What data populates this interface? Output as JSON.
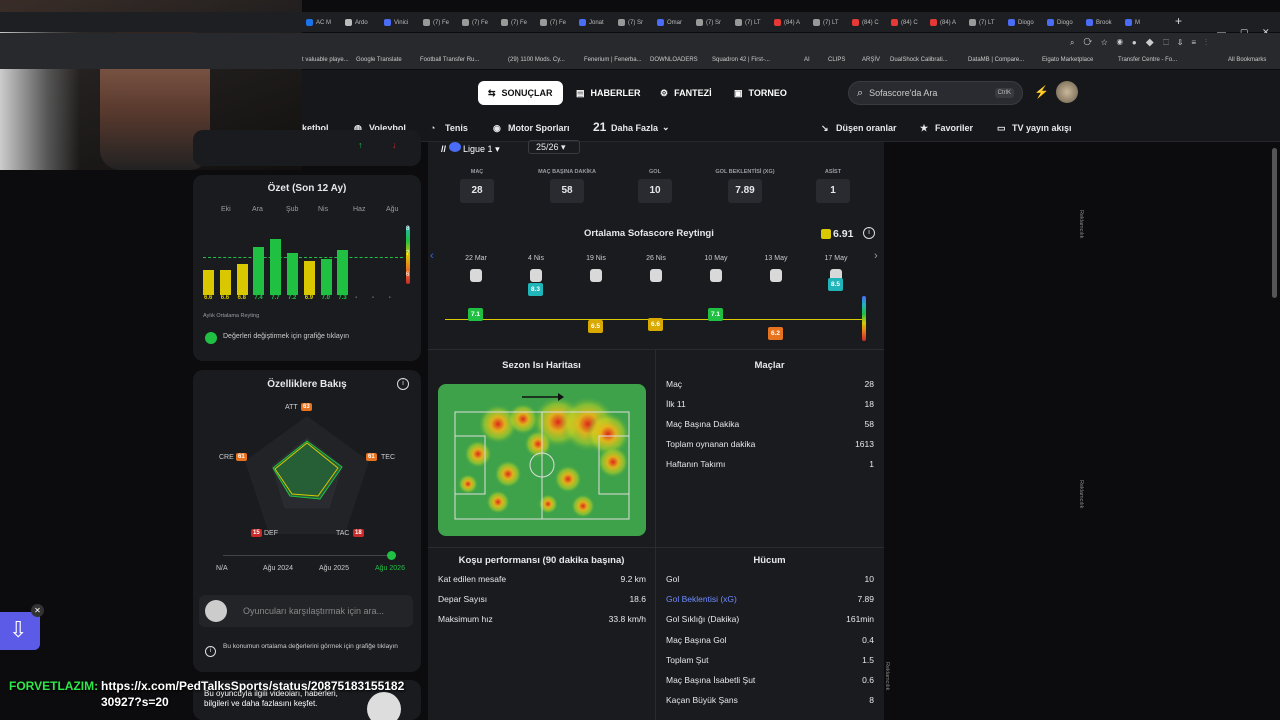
{
  "browser": {
    "tabs": [
      {
        "label": "AC M",
        "c": "#1a73e8"
      },
      {
        "label": "Ardo",
        "c": "#bbb"
      },
      {
        "label": "Vinici",
        "c": "#4a6cf7"
      },
      {
        "label": "(7) Fe",
        "c": "#999"
      },
      {
        "label": "(7) Fe",
        "c": "#999"
      },
      {
        "label": "(7) Fe",
        "c": "#999"
      },
      {
        "label": "(7) Fe",
        "c": "#999"
      },
      {
        "label": "Jonat",
        "c": "#4a6cf7"
      },
      {
        "label": "(7) Sr",
        "c": "#999"
      },
      {
        "label": "Omar",
        "c": "#4a6cf7"
      },
      {
        "label": "(7) Sr",
        "c": "#999"
      },
      {
        "label": "(7) LT",
        "c": "#999"
      },
      {
        "label": "(84) A",
        "c": "#e53935"
      },
      {
        "label": "(7) LT",
        "c": "#999"
      },
      {
        "label": "(84) C",
        "c": "#e53935"
      },
      {
        "label": "(84) C",
        "c": "#e53935"
      },
      {
        "label": "(84) A",
        "c": "#e53935"
      },
      {
        "label": "(7) LT",
        "c": "#999"
      },
      {
        "label": "Diogo",
        "c": "#4a6cf7"
      },
      {
        "label": "Diogo",
        "c": "#4a6cf7"
      },
      {
        "label": "Brook",
        "c": "#4a6cf7"
      },
      {
        "label": "M",
        "c": "#4a6cf7"
      }
    ],
    "bookmarks": [
      "t valuable playe...",
      "Google Translate",
      "Football Transfer Ru...",
      "(29) 1100 Mods. Cy...",
      "Fenerium | Fenerba...",
      "DOWNLOADERS",
      "Squadron 42 | First-...",
      "AI",
      "CLIPS",
      "ARŞİV",
      "DualShock Calibrati...",
      "DataMB | Compare...",
      "Eigato Marketplace",
      "Transfer Centre - Fo...",
      "All Bookmarks"
    ]
  },
  "nav": {
    "sonuclar": "SONUÇLAR",
    "haberler": "HABERLER",
    "fantezi": "FANTEZİ",
    "torneo": "TORNEO",
    "search_placeholder": "Sofascore'da Ara",
    "search_kbd": "CtrlK"
  },
  "sports": {
    "basketbol": "ketbol",
    "voleybol": "Voleybol",
    "tenis": "Tenis",
    "motor": "Motor Sporları",
    "more_count": "21",
    "more": "Daha Fazla",
    "odds": "Düşen oranlar",
    "favorites": "Favoriler",
    "tv": "TV yayın akışı"
  },
  "left": {
    "summary_title": "Özet (Son 12 Ay)",
    "months": [
      "Eki",
      "Ara",
      "Şub",
      "Nis",
      "Haz",
      "Ağu"
    ],
    "bar_ratings": [
      6.6,
      6.6,
      6.8,
      7.4,
      7.7,
      7.2,
      6.9,
      7.0,
      7.3
    ],
    "bar_labels": [
      "6.6",
      "6.6",
      "6.8",
      "7.4",
      "7.7",
      "7.2",
      "6.9",
      "7.0",
      "7.3",
      "-",
      "-",
      "-"
    ],
    "scale": [
      "8",
      "7",
      "6"
    ],
    "monthly_label": "Aylık Ortalama Reyting",
    "hint": "Değerleri değiştirmek için grafiğe tıklayın",
    "attr_title": "Özelliklere Bakış",
    "attrs": {
      "att_label": "ATT",
      "att": "63",
      "tec_label": "TEC",
      "tec": "61",
      "tac_label": "TAC",
      "tac": "18",
      "def_label": "DEF",
      "def": "15",
      "cre_label": "CRE",
      "cre": "61"
    },
    "timeline": [
      "N/A",
      "Ağu 2024",
      "Ağu 2025",
      "Ağu 2026"
    ],
    "compare_placeholder": "Oyuncuları karşılaştırmak için ara...",
    "avg_hint": "Bu konumun ortalama değerlerini görmek için grafiğe tıklayın",
    "video_text": "Bu oyuncuyla ilgili videoları, haberleri, bilgileri ve daha fazlasını keşfet."
  },
  "mid": {
    "league": "Ligue 1",
    "season": "25/26",
    "stats": [
      {
        "label": "MAÇ",
        "value": "28"
      },
      {
        "label": "MAÇ BAŞINA DAKİKA",
        "value": "58"
      },
      {
        "label": "GOL",
        "value": "10"
      },
      {
        "label": "GOL BEKLENTİSİ (XG)",
        "value": "7.89"
      },
      {
        "label": "ASİST",
        "value": "1"
      }
    ],
    "avg_title": "Ortalama Sofascore Reytingi",
    "avg_value": "6.91",
    "matches": [
      {
        "date": "22 Mar",
        "rating": "7.1",
        "color": "#20c043"
      },
      {
        "date": "4 Nis",
        "rating": "8.3",
        "color": "#1fb5b9"
      },
      {
        "date": "19 Nis",
        "rating": "6.5",
        "color": "#d9a900"
      },
      {
        "date": "26 Nis",
        "rating": "6.6",
        "color": "#d9a900"
      },
      {
        "date": "10 May",
        "rating": "7.1",
        "color": "#20c043"
      },
      {
        "date": "13 May",
        "rating": "6.2",
        "color": "#e8731f"
      },
      {
        "date": "17 May",
        "rating": "8.5",
        "color": "#1fb5b9"
      }
    ],
    "heatmap_title": "Sezon Isı Haritası",
    "matches_title": "Maçlar",
    "matches_rows": [
      {
        "label": "Maç",
        "value": "28"
      },
      {
        "label": "İlk 11",
        "value": "18"
      },
      {
        "label": "Maç Başına Dakika",
        "value": "58"
      },
      {
        "label": "Toplam oynanan dakika",
        "value": "1613"
      },
      {
        "label": "Haftanın Takımı",
        "value": "1"
      }
    ],
    "run_title": "Koşu performansı (90 dakika başına)",
    "run_rows": [
      {
        "label": "Kat edilen mesafe",
        "value": "9.2 km"
      },
      {
        "label": "Depar Sayısı",
        "value": "18.6"
      },
      {
        "label": "Maksimum hız",
        "value": "33.8 km/h"
      }
    ],
    "attack_title": "Hücum",
    "attack_rows": [
      {
        "label": "Gol",
        "value": "10"
      },
      {
        "label": "Gol Beklentisi (xG)",
        "value": "7.89"
      },
      {
        "label": "Gol Sıklığı (Dakika)",
        "value": "161min"
      },
      {
        "label": "Maç Başına Gol",
        "value": "0.4"
      },
      {
        "label": "Toplam Şut",
        "value": "1.5"
      },
      {
        "label": "Maç Başına İsabetli Şut",
        "value": "0.6"
      },
      {
        "label": "Kaçan Büyük Şans",
        "value": "8"
      }
    ]
  },
  "ads": {
    "label": "Reklamcılık"
  },
  "stream": {
    "user": "FORVETLAZIM:",
    "url1": "https://x.com/PedTalksSports/status/20875183155182",
    "url2": "30927?s=20"
  },
  "colors": {
    "accent": "#2b6cf5",
    "green": "#20c043",
    "yellow": "#d9c800",
    "orange": "#e8731f",
    "red": "#c82a2a"
  }
}
